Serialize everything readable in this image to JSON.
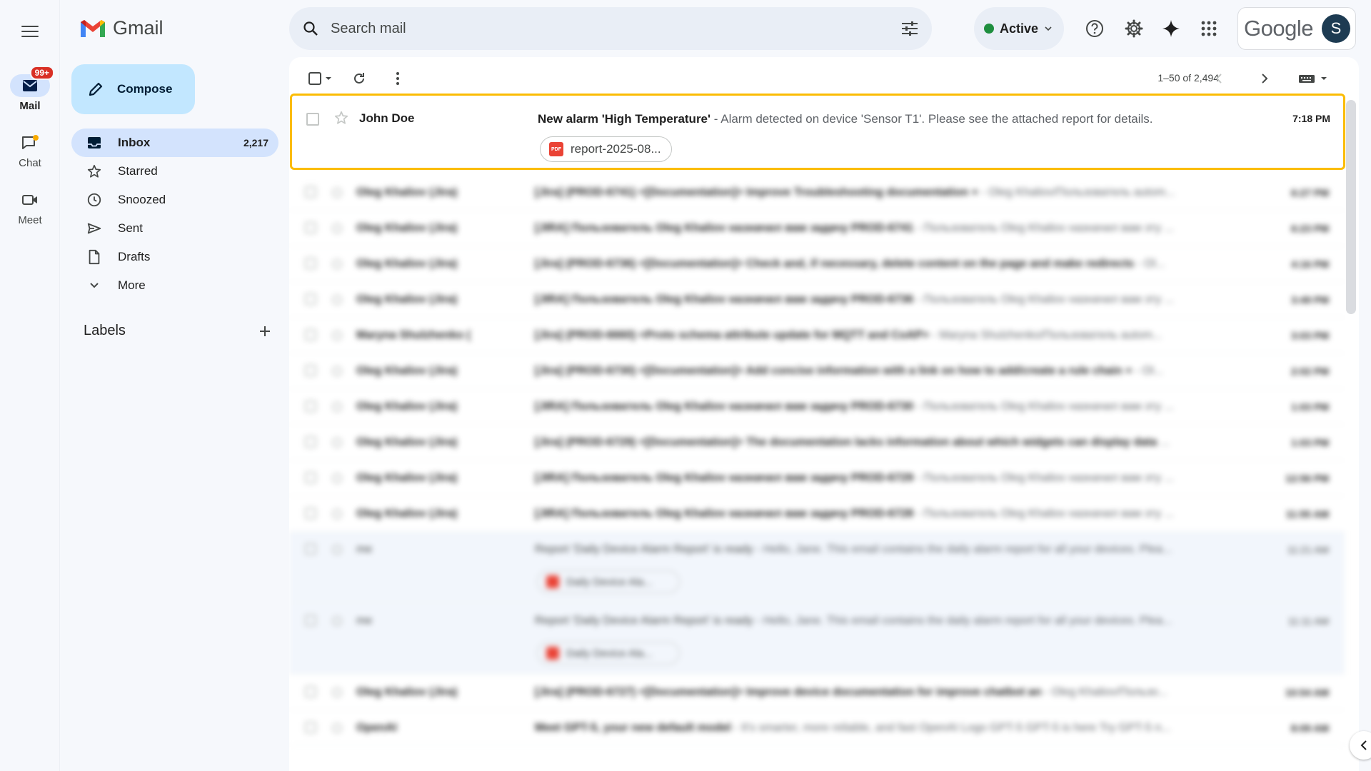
{
  "app": {
    "name": "Gmail"
  },
  "rail": [
    {
      "label": "Mail",
      "badge": "99+",
      "icon": "mail-icon"
    },
    {
      "label": "Chat",
      "icon": "chat-icon"
    },
    {
      "label": "Meet",
      "icon": "video-icon"
    }
  ],
  "compose": {
    "label": "Compose"
  },
  "nav": [
    {
      "label": "Inbox",
      "count": "2,217",
      "icon": "inbox-icon"
    },
    {
      "label": "Starred",
      "icon": "star-icon"
    },
    {
      "label": "Snoozed",
      "icon": "clock-icon"
    },
    {
      "label": "Sent",
      "icon": "send-icon"
    },
    {
      "label": "Drafts",
      "icon": "draft-icon"
    },
    {
      "label": "More",
      "icon": "chevron-down-icon"
    }
  ],
  "labels": {
    "title": "Labels"
  },
  "search": {
    "placeholder": "Search mail"
  },
  "status": {
    "label": "Active",
    "color": "#1e8e3e"
  },
  "account": {
    "brand": "Google",
    "initial": "S"
  },
  "toolbar": {
    "pagination": "1–50 of 2,494"
  },
  "featured": {
    "sender": "John Doe",
    "subject": "New alarm 'High Temperature'",
    "snippet": " - Alarm detected on device 'Sensor T1'. Please see the attached report for details.",
    "time": "7:18 PM",
    "attachment": "report-2025-08...",
    "highlight_color": "#fbbc04"
  },
  "emails": [
    {
      "sender": "Oleg Khaliov (Jira)",
      "subject": "[Jira] (PROD-6741) <[Documentation]> Improve Troubleshooting documentation +",
      "snippet": " - Oleg Khaliov/Пользователь autom...",
      "time": "6:27 PM"
    },
    {
      "sender": "Oleg Khaliov (Jira)",
      "subject": "[JIRA] Пользователь Oleg Khaliov назначил вам задачу PROD-6741",
      "snippet": " - Пользователь Oleg Khaliov назначил вам эту ...",
      "time": "6:23 PM"
    },
    {
      "sender": "Oleg Khaliov (Jira)",
      "subject": "[Jira] (PROD-6736) <[Documentation]> Check and, if necessary, delete content on the page and make redirects",
      "snippet": " - Ol...",
      "time": "4:16 PM"
    },
    {
      "sender": "Oleg Khaliov (Jira)",
      "subject": "[JIRA] Пользователь Oleg Khaliov назначил вам задачу PROD-6736",
      "snippet": " - Пользователь Oleg Khaliov назначил вам эту ...",
      "time": "3:49 PM"
    },
    {
      "sender": "Maryna Shulzhenko (",
      "subject": "[Jira] (PROD-6660) <Proto schema attribute update for MQTT and CoAP>",
      "snippet": " - Maryna Shulzhenko/Пользователь autom...",
      "time": "3:03 PM"
    },
    {
      "sender": "Oleg Khaliov (Jira)",
      "subject": "[Jira] (PROD-6730) <[Documentation]> Add concise information with a link on how to add/create a rule chain +",
      "snippet": " - Ol...",
      "time": "2:02 PM"
    },
    {
      "sender": "Oleg Khaliov (Jira)",
      "subject": "[JIRA] Пользователь Oleg Khaliov назначил вам задачу PROD-6730",
      "snippet": " - Пользователь Oleg Khaliov назначил вам эту ...",
      "time": "1:03 PM"
    },
    {
      "sender": "Oleg Khaliov (Jira)",
      "subject": "[Jira] (PROD-6729) <[Documentation]> The documentation lacks information about which widgets can display data",
      "snippet": " ...",
      "time": "1:03 PM"
    },
    {
      "sender": "Oleg Khaliov (Jira)",
      "subject": "[JIRA] Пользователь Oleg Khaliov назначил вам задачу PROD-6729",
      "snippet": " - Пользователь Oleg Khaliov назначил вам эту ...",
      "time": "12:56 PM"
    },
    {
      "sender": "Oleg Khaliov (Jira)",
      "subject": "[JIRA] Пользователь Oleg Khaliov назначил вам задачу PROD-6728",
      "snippet": " - Пользователь Oleg Khaliov назначил вам эту ...",
      "time": "11:55 AM"
    },
    {
      "sender": "me",
      "subject": "Report 'Daily Device Alarm Report' is ready",
      "snippet": " - Hello, Jane. This email contains the daily alarm report for all your devices. Plea...",
      "time": "11:21 AM",
      "attachment": "Daily Device Ala..."
    },
    {
      "sender": "me",
      "subject": "Report 'Daily Device Alarm Report' is ready",
      "snippet": " - Hello, Jane. This email contains the daily alarm report for all your devices. Plea...",
      "time": "11:11 AM",
      "attachment": "Daily Device Ala..."
    },
    {
      "sender": "Oleg Khaliov (Jira)",
      "subject": "[Jira] (PROD-6727) <[Documentation]> Improve device documentation for improve chatbot an",
      "snippet": " - Oleg Khaliov/Пользо...",
      "time": "10:54 AM"
    },
    {
      "sender": "OpenAI",
      "subject": "Meet GPT-5, your new default model",
      "snippet": " - It's smarter, more reliable, and fast OpenAI Logo GPT-5 GPT-5 is here Try GPT-5 n...",
      "time": "8:09 AM"
    }
  ]
}
